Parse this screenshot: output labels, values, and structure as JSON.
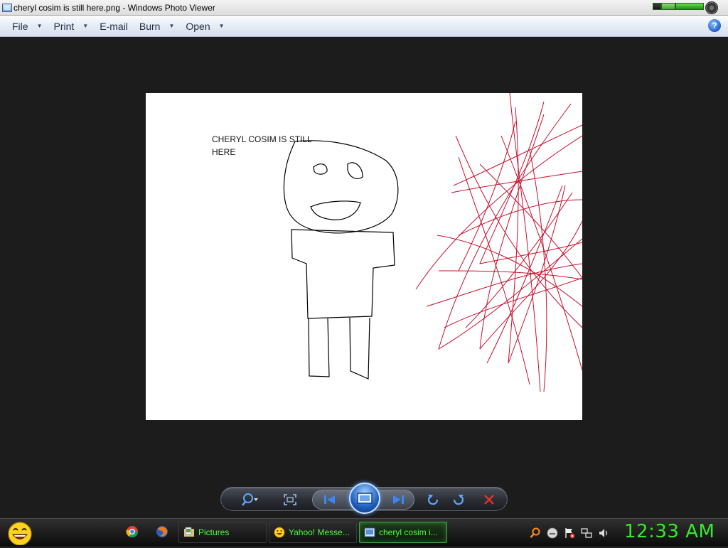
{
  "window": {
    "title": "cheryl cosim is still here.png - Windows Photo Viewer"
  },
  "menu": {
    "file": "File",
    "print": "Print",
    "email": "E-mail",
    "burn": "Burn",
    "open": "Open",
    "help_glyph": "?"
  },
  "image": {
    "text_line1": "CHERYL COSIM IS STILL",
    "text_line2": "HERE"
  },
  "controls": {
    "icons": [
      "zoom-icon",
      "actual-size-icon",
      "previous-icon",
      "slideshow-icon",
      "next-icon",
      "rotate-counterclockwise-icon",
      "rotate-clockwise-icon",
      "delete-icon"
    ]
  },
  "taskbar": {
    "tasks": [
      {
        "label": "Pictures"
      },
      {
        "label": "Yahoo! Messe..."
      },
      {
        "label": "cheryl cosim i..."
      }
    ],
    "clock": "12:33 AM"
  },
  "colors": {
    "scribble": "#c8102e",
    "taskbar_text": "#4cff3a",
    "clock": "#38e82c"
  }
}
